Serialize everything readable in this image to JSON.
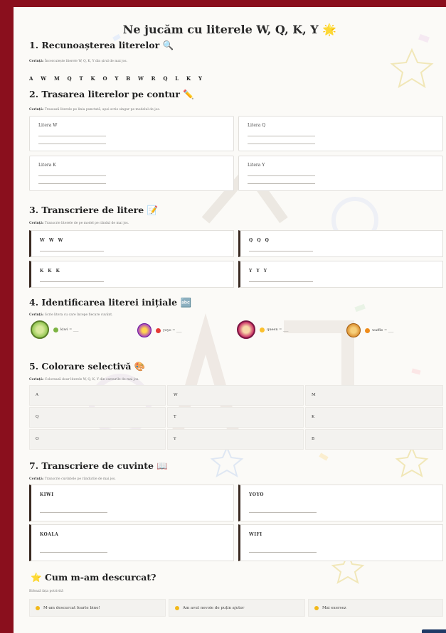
{
  "title": "Ne jucăm cu literele W, Q, K, Y",
  "title_emoji": "🌟",
  "sections": {
    "s1": {
      "title": "1. Recunoașterea literelor",
      "emoji": "🔍",
      "instruction_label": "Cerință:",
      "instruction_text": "Încercuiește literele W, Q, K, Y din șirul de mai jos.",
      "letters": "A W M Q T K O Y B W R Q L K Y"
    },
    "s2": {
      "title": "2. Trasarea literelor pe contur",
      "emoji": "✏️",
      "instruction_label": "Cerință:",
      "instruction_text": "Trasează literele pe linia punctată, apoi scrie singur pe modelul de jos.",
      "boxes": [
        "Litera W",
        "Litera Q",
        "Litera K",
        "Litera Y"
      ]
    },
    "s3": {
      "title": "3. Transcriere de litere",
      "emoji": "📝",
      "instruction_label": "Cerință:",
      "instruction_text": "Transcrie literele de pe model pe rândul de mai jos.",
      "boxes": [
        "W W W",
        "Q Q Q",
        "K K K",
        "Y Y Y"
      ]
    },
    "s4": {
      "title": "4. Identificarea literei inițiale",
      "emoji": "🔤",
      "instruction_label": "Cerință:",
      "instruction_text": "Scrie litera cu care începe fiecare cuvânt.",
      "items": [
        {
          "word": "kiwi = ___",
          "dot_color": "#7cb342",
          "fruit_color": "#8bc34a"
        },
        {
          "word": "yoyo = ___",
          "dot_color": "#e53935",
          "fruit_color": "#ab47bc"
        },
        {
          "word": "queen = ___",
          "dot_color": "#fbc02d",
          "fruit_color": "#c2185b"
        },
        {
          "word": "waffle = ___",
          "dot_color": "#ef8c1a",
          "fruit_color": "#f0a23a"
        }
      ]
    },
    "s5": {
      "title": "5. Colorare selectivă",
      "emoji": "🎨",
      "instruction_label": "Cerință:",
      "instruction_text": "Colorează doar literele W, Q, K, Y din careurile de mai jos.",
      "cells": [
        "A",
        "W",
        "M",
        "Q",
        "T",
        "K",
        "O",
        "Y",
        "B"
      ]
    },
    "s7": {
      "title": "7. Transcriere de cuvinte",
      "emoji": "📖",
      "instruction_label": "Cerință:",
      "instruction_text": "Transcrie cuvintele pe rândurile de mai jos.",
      "boxes": [
        "KIWI",
        "YOYO",
        "KOALA",
        "WIFI"
      ]
    },
    "eval": {
      "emoji": "⭐",
      "title": "Cum m-am descurcat?",
      "subtitle": "Bifează fața potrivită",
      "options": [
        "M-am descurcat foarte bine!",
        "Am avut nevoie de puțin ajutor",
        "Mai exersez"
      ]
    }
  },
  "colors": {
    "frame": "#8a0f1d",
    "sheet": "#fbfaf7",
    "accent_bar": "#3a2a22",
    "eval_dot": "#f2b91b"
  }
}
